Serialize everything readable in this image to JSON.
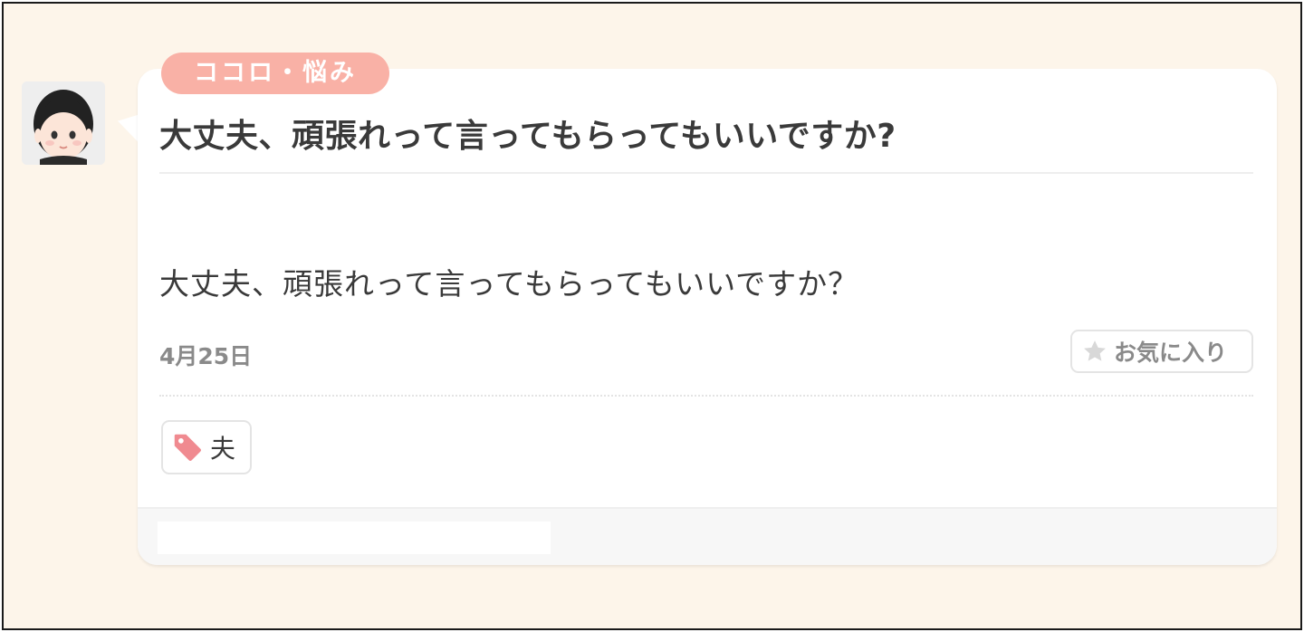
{
  "post": {
    "category": "ココロ・悩み",
    "title": "大丈夫、頑張れって言ってもらってもいいですか?",
    "body": "大丈夫、頑張れって言ってもらってもいいですか？",
    "date": "4月25日",
    "favorite_label": "お気に入り",
    "tags": [
      "夫"
    ]
  },
  "icons": {
    "avatar": "avatar-woman-icon",
    "favorite": "star-icon",
    "tag": "tag-icon"
  },
  "colors": {
    "background": "#fdf5ea",
    "category_badge": "#f9b1a6",
    "tag_icon": "#f08a90"
  }
}
